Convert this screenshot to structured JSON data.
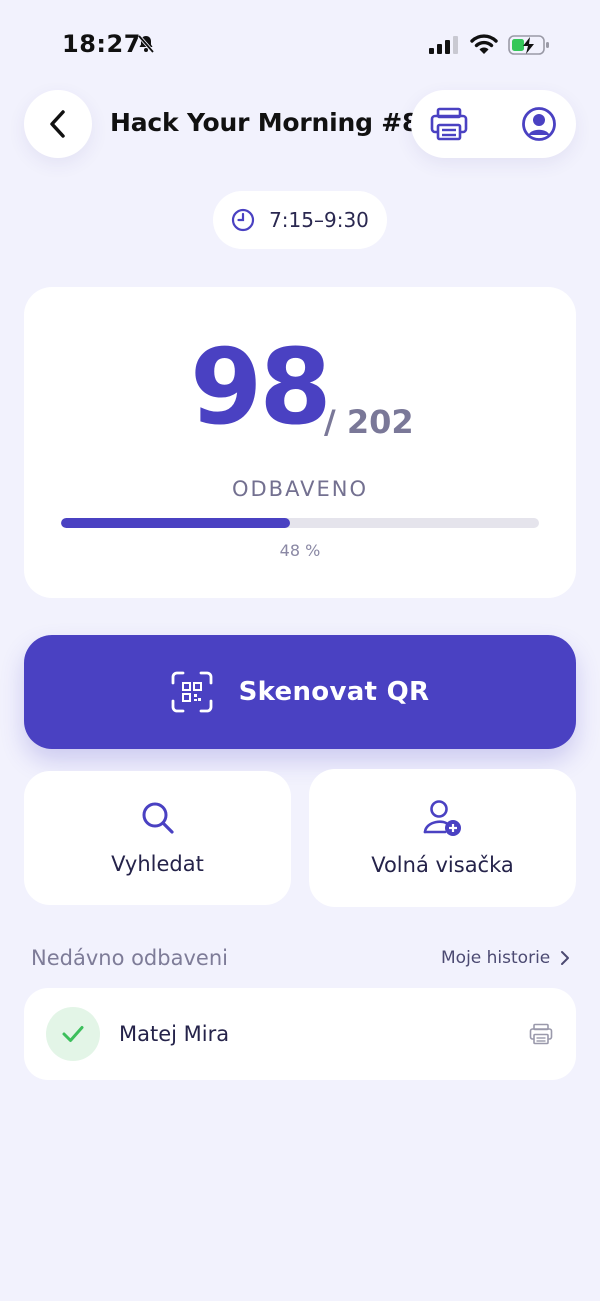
{
  "status_bar": {
    "time": "18:27",
    "icons": [
      "bell-slash-icon",
      "signal-icon",
      "wifi-icon",
      "battery-charging-icon"
    ]
  },
  "header": {
    "title": "Hack Your Morning #8",
    "back_icon": "chevron-left-icon",
    "actions": [
      "printer-icon",
      "user-circle-icon"
    ]
  },
  "time_range": {
    "icon": "clock-icon",
    "text": "7:15–9:30"
  },
  "stats": {
    "checked_in": "98",
    "total": "/ 202",
    "label": "ODBAVENO",
    "progress_percent": 48,
    "progress_text": "48 %"
  },
  "scan_button": {
    "icon": "qr-scan-icon",
    "label": "Skenovat QR"
  },
  "actions": {
    "search": {
      "icon": "search-icon",
      "label": "Vyhledat"
    },
    "free_badge": {
      "icon": "user-plus-icon",
      "label": "Volná visačka"
    }
  },
  "recent": {
    "title": "Nedávno odbaveni",
    "history_link": "Moje historie",
    "items": [
      {
        "name": "Matej Mira",
        "status_icon": "check-icon",
        "action_icon": "printer-icon"
      }
    ]
  },
  "colors": {
    "accent": "#4a41c2",
    "background": "#f2f2fd",
    "success": "#3cbf5c"
  }
}
